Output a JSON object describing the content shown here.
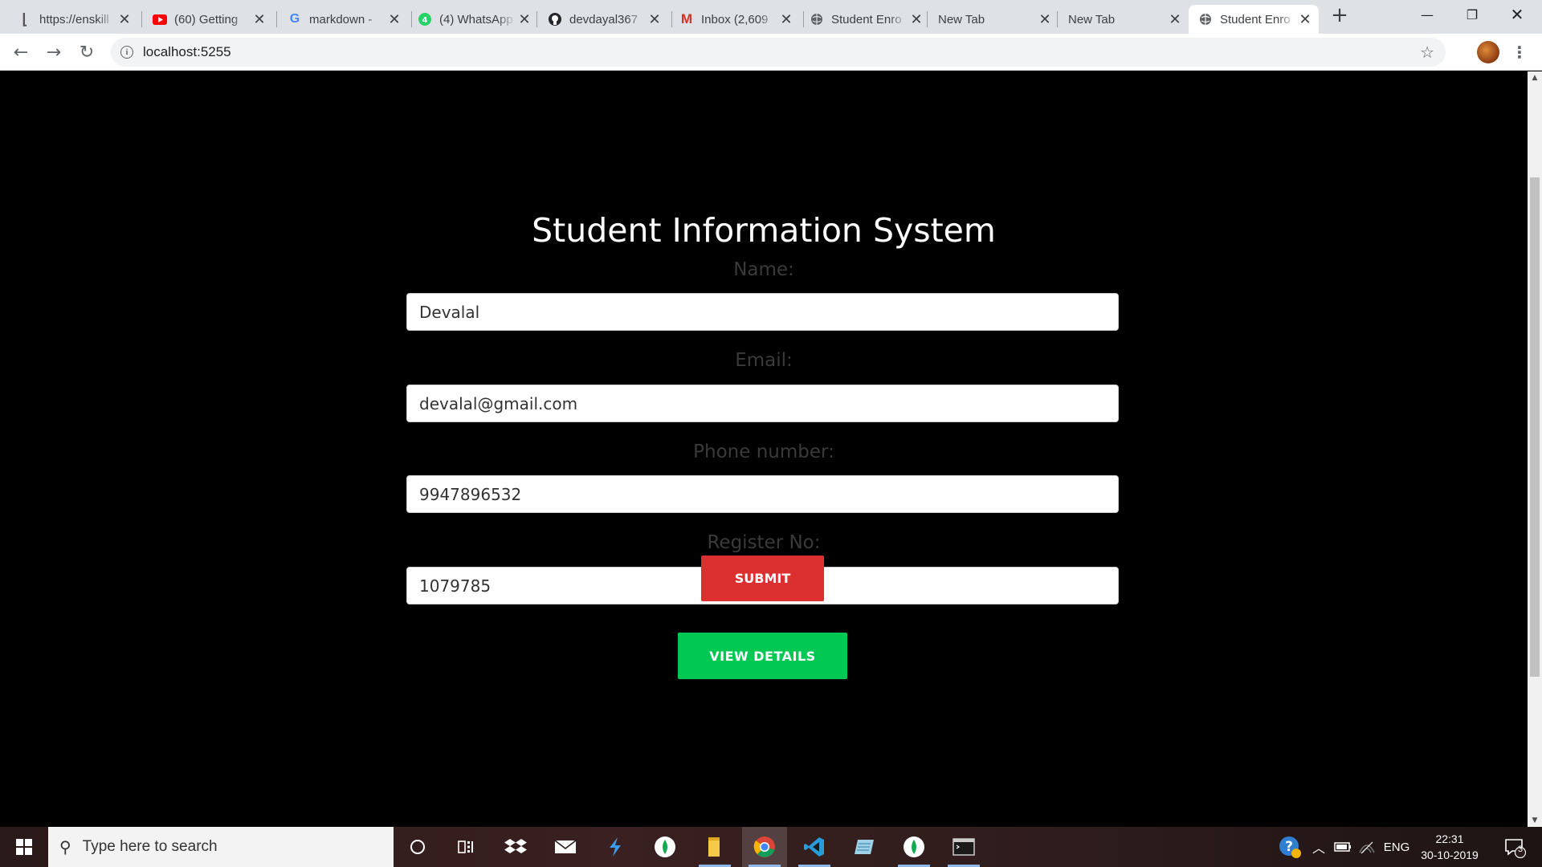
{
  "browser": {
    "tabs": [
      {
        "title": "https://enskill",
        "favicon": "enskill-icon"
      },
      {
        "title": "(60) Getting",
        "favicon": "youtube-icon"
      },
      {
        "title": "markdown -",
        "favicon": "google-icon"
      },
      {
        "title": "(4) WhatsApp",
        "favicon": "whatsapp-icon"
      },
      {
        "title": "devdayal367",
        "favicon": "github-icon"
      },
      {
        "title": "Inbox (2,609",
        "favicon": "gmail-icon"
      },
      {
        "title": "Student Enro",
        "favicon": "globe-icon"
      },
      {
        "title": "New Tab",
        "favicon": ""
      },
      {
        "title": "New Tab",
        "favicon": ""
      },
      {
        "title": "Student Enro",
        "favicon": "globe-icon",
        "active": true
      }
    ],
    "url": "localhost:5255"
  },
  "page": {
    "title": "Student Information System",
    "fields": [
      {
        "label": "Name:",
        "value": "Devalal"
      },
      {
        "label": "Email:",
        "value": "devalal@gmail.com"
      },
      {
        "label": "Phone number:",
        "value": "9947896532"
      },
      {
        "label": "Register No:",
        "value": "1079785"
      }
    ],
    "submit_label": "SUBMIT",
    "view_label": "VIEW DETAILS"
  },
  "taskbar": {
    "search_placeholder": "Type here to search",
    "language": "ENG",
    "time": "22:31",
    "date": "30-10-2019",
    "notification_count": "3"
  },
  "colors": {
    "submit": "#dc3030",
    "view_details": "#00c853",
    "page_bg": "#000000"
  }
}
